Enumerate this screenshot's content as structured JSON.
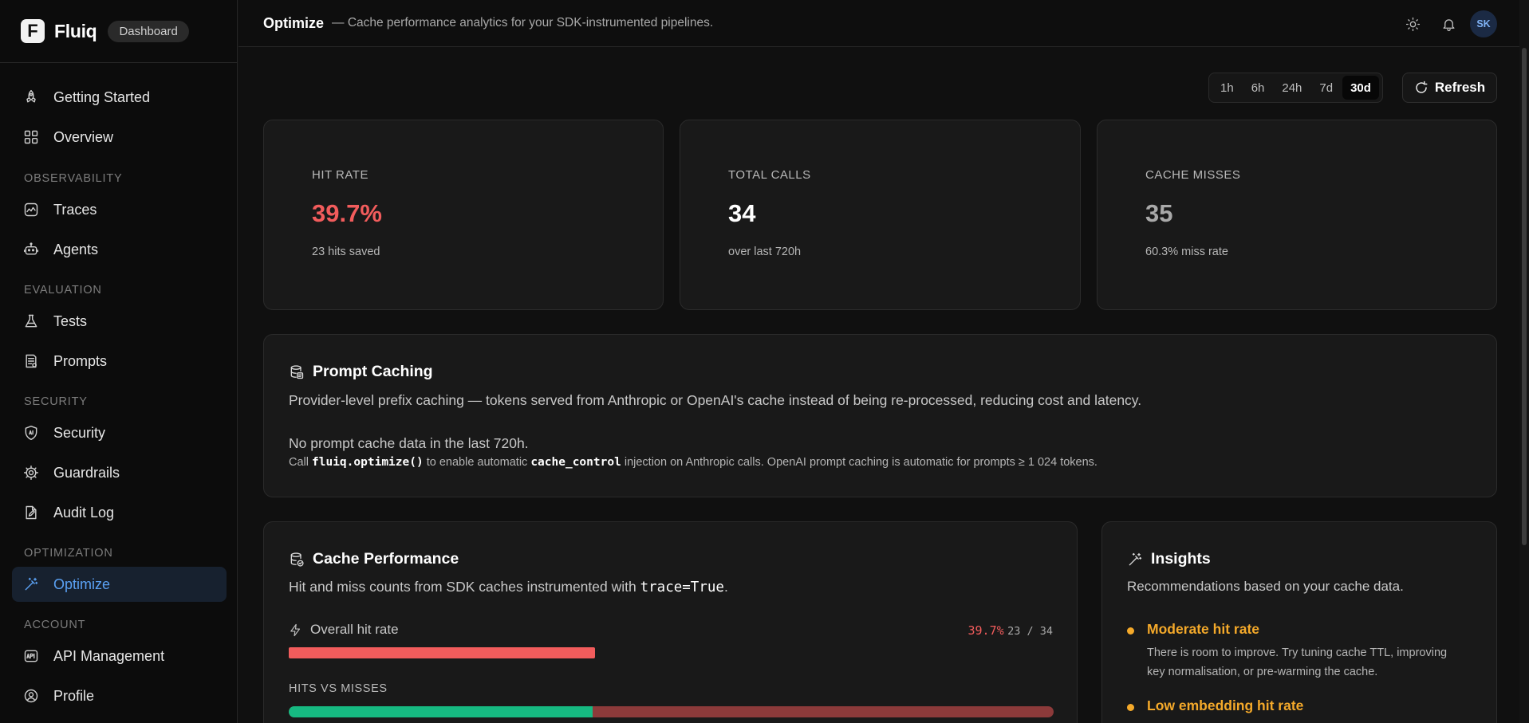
{
  "brand": {
    "name": "Fluiq",
    "logo_letter": "F",
    "badge": "Dashboard"
  },
  "sidebar": {
    "items": [
      {
        "label": "Getting Started",
        "icon": "rocket-icon"
      },
      {
        "label": "Overview",
        "icon": "grid-icon"
      },
      {
        "section": "OBSERVABILITY"
      },
      {
        "label": "Traces",
        "icon": "activity-icon"
      },
      {
        "label": "Agents",
        "icon": "bot-icon"
      },
      {
        "section": "EVALUATION"
      },
      {
        "label": "Tests",
        "icon": "flask-icon"
      },
      {
        "label": "Prompts",
        "icon": "prompt-icon"
      },
      {
        "section": "SECURITY"
      },
      {
        "label": "Security",
        "icon": "shield-icon"
      },
      {
        "label": "Guardrails",
        "icon": "gear-icon"
      },
      {
        "label": "Audit Log",
        "icon": "file-edit-icon"
      },
      {
        "section": "OPTIMIZATION"
      },
      {
        "label": "Optimize",
        "icon": "wand-icon",
        "active": true
      },
      {
        "section": "ACCOUNT"
      },
      {
        "label": "API Management",
        "icon": "api-icon"
      },
      {
        "label": "Profile",
        "icon": "user-circle-icon"
      }
    ]
  },
  "topbar": {
    "title": "Optimize",
    "subtitle": "— Cache performance analytics for your SDK-instrumented pipelines.",
    "avatar": "SK"
  },
  "time_range": {
    "options": [
      "1h",
      "6h",
      "24h",
      "7d",
      "30d"
    ],
    "selected": "30d"
  },
  "refresh_label": "Refresh",
  "stats": [
    {
      "label": "HIT RATE",
      "value": "39.7%",
      "sub": "23 hits saved",
      "color": "#f25c5c"
    },
    {
      "label": "TOTAL CALLS",
      "value": "34",
      "sub": "over last 720h",
      "color": "#ffffff"
    },
    {
      "label": "CACHE MISSES",
      "value": "35",
      "sub": "60.3% miss rate",
      "color": "#a9a9a9"
    }
  ],
  "prompt_caching": {
    "title": "Prompt Caching",
    "description": "Provider-level prefix caching — tokens served from Anthropic or OpenAI's cache instead of being re-processed, reducing cost and latency.",
    "empty": "No prompt cache data in the last 720h.",
    "hint_1": "Call ",
    "hint_code_1": "fluiq.optimize()",
    "hint_2": " to enable automatic ",
    "hint_code_2": "cache_control",
    "hint_3": " injection on Anthropic calls. OpenAI prompt caching is automatic for prompts ≥ 1 024 tokens."
  },
  "cache_performance": {
    "title": "Cache Performance",
    "description_1": "Hit and miss counts from SDK caches instrumented with ",
    "description_code": "trace=True",
    "description_2": ".",
    "overall_label": "Overall hit rate",
    "overall_pct": "39.7%",
    "overall_count": "23 / 34",
    "overall_fraction": 0.4,
    "hits_vs_misses_label": "HITS VS MISSES",
    "hits_fraction": 0.397,
    "colors": {
      "hit_bar": "#f25c5c",
      "hits": "#16b981",
      "misses": "#8c3a3a"
    }
  },
  "insights": {
    "title": "Insights",
    "description": "Recommendations based on your cache data.",
    "items": [
      {
        "title": "Moderate hit rate",
        "body": "There is room to improve. Try tuning cache TTL, improving key normalisation, or pre-warming the cache."
      },
      {
        "title": "Low embedding hit rate",
        "body": ""
      }
    ]
  }
}
